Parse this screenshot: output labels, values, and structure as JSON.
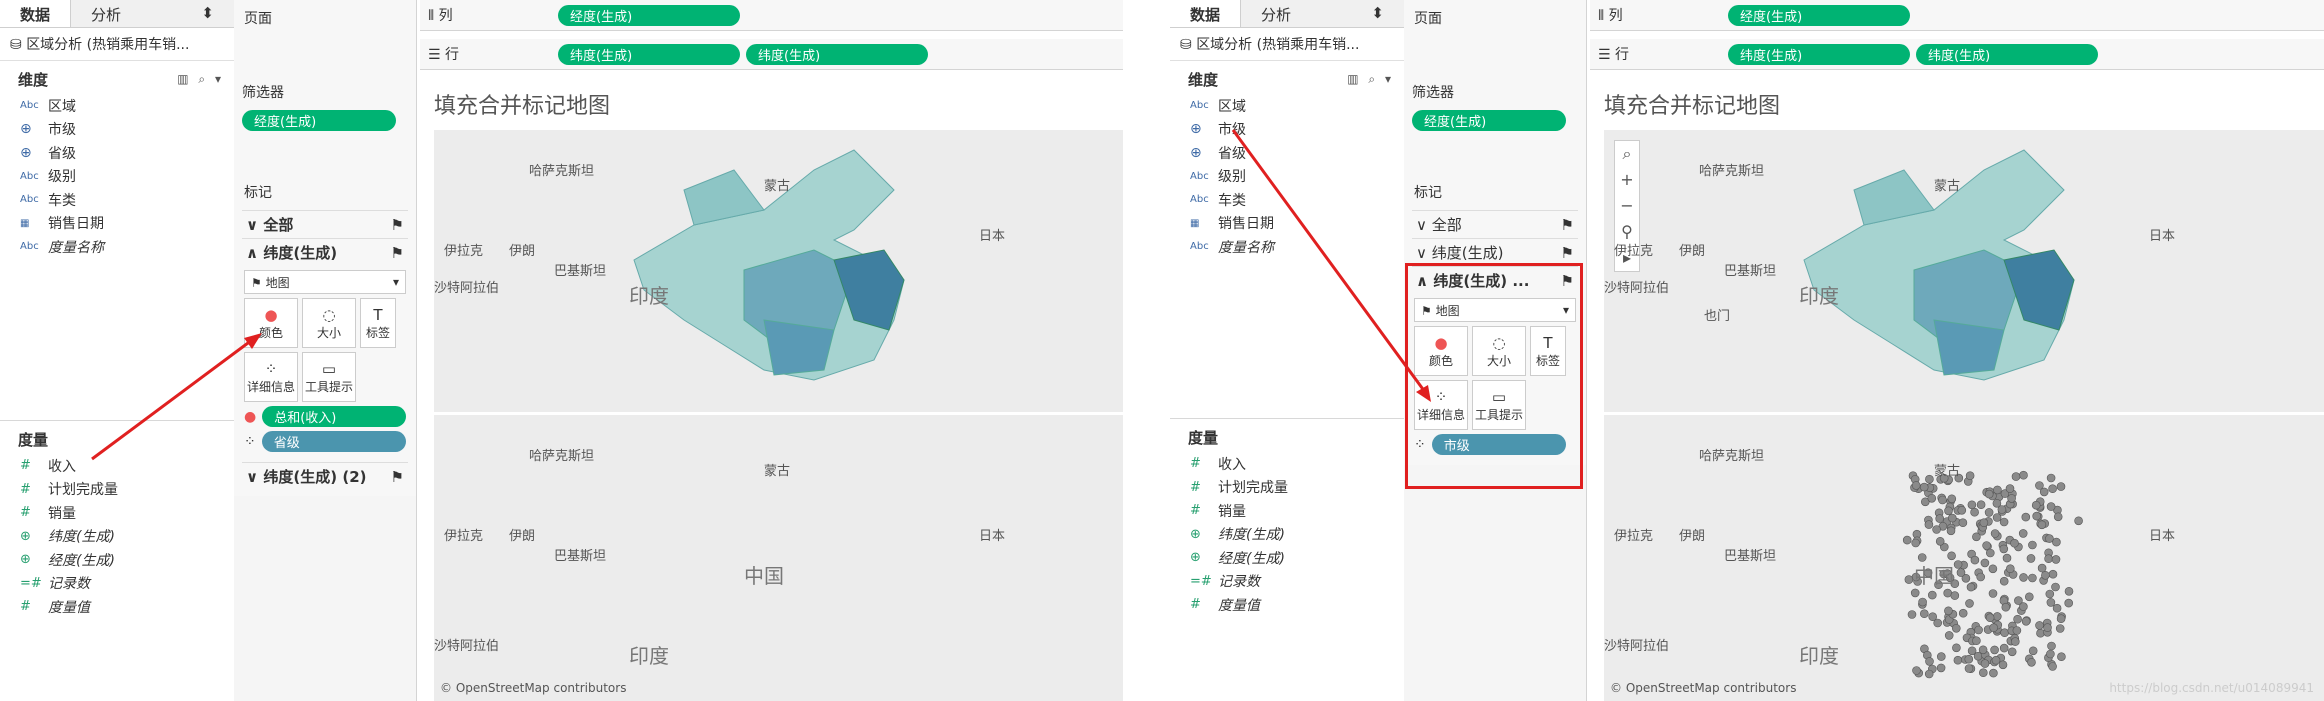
{
  "tabs": {
    "data": "数据",
    "analysis": "分析"
  },
  "datasource": "区域分析 (热销乘用车销...",
  "dimensions_header": "维度",
  "dimensions": [
    {
      "icon": "Abc",
      "label": "区域"
    },
    {
      "icon": "globe",
      "label": "市级"
    },
    {
      "icon": "globe",
      "label": "省级"
    },
    {
      "icon": "Abc",
      "label": "级别"
    },
    {
      "icon": "Abc",
      "label": "车类"
    },
    {
      "icon": "calendar",
      "label": "销售日期"
    },
    {
      "icon": "Abc",
      "label": "度量名称"
    }
  ],
  "measures_header": "度量",
  "measures": [
    {
      "icon": "#",
      "label": "收入"
    },
    {
      "icon": "#",
      "label": "计划完成量"
    },
    {
      "icon": "#",
      "label": "销量"
    },
    {
      "icon": "globe",
      "label": "纬度(生成)"
    },
    {
      "icon": "globe",
      "label": "经度(生成)"
    },
    {
      "icon": "=#",
      "label": "记录数"
    },
    {
      "icon": "#",
      "label": "度量值"
    }
  ],
  "pages_label": "页面",
  "filters_label": "筛选器",
  "filter_pill": "经度(生成)",
  "marks_label": "标记",
  "columns_label": "列",
  "rows_label": "行",
  "columns_pill": "经度(生成)",
  "rows_pills": [
    "纬度(生成)",
    "纬度(生成)"
  ],
  "view_title": "填充合并标记地图",
  "left": {
    "layers": [
      "全部",
      "纬度(生成)",
      "纬度(生成) (2)"
    ],
    "mark_type": "地图",
    "buttons": [
      "颜色",
      "大小",
      "标签",
      "详细信息",
      "工具提示"
    ],
    "encodings": [
      "总和(收入)",
      "省级"
    ]
  },
  "right": {
    "layers": [
      "全部",
      "纬度(生成)",
      "纬度(生成) ..."
    ],
    "mark_type": "地图",
    "buttons": [
      "颜色",
      "大小",
      "标签",
      "详细信息",
      "工具提示"
    ],
    "encoding": "市级"
  },
  "map_labels": {
    "kazakhstan": "哈萨克斯坦",
    "mongolia": "蒙古",
    "china": "中国",
    "japan": "日本",
    "iraq": "伊拉克",
    "iran": "伊朗",
    "pakistan": "巴基斯坦",
    "saudi": "沙特阿拉伯",
    "india": "印度",
    "yemen": "也门"
  },
  "credit": "© OpenStreetMap contributors",
  "watermark": "https://blog.csdn.net/u014089941"
}
